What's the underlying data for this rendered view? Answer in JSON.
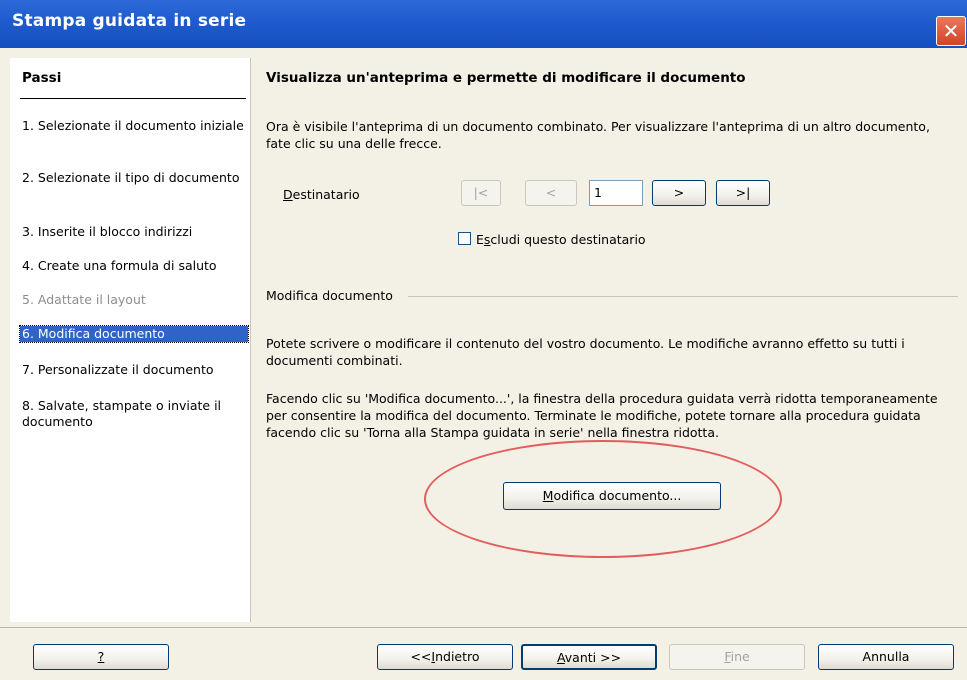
{
  "window": {
    "title": "Stampa guidata in serie",
    "close_glyph": "✕"
  },
  "sidebar": {
    "heading": "Passi",
    "steps": [
      {
        "label": "1. Selezionate il documento iniziale",
        "state": "normal"
      },
      {
        "label": "2. Selezionate il tipo di documento",
        "state": "normal"
      },
      {
        "label": "3. Inserite il blocco indirizzi",
        "state": "normal"
      },
      {
        "label": "4. Create una formula di saluto",
        "state": "normal"
      },
      {
        "label": "5. Adattate il layout",
        "state": "disabled"
      },
      {
        "label": "6. Modifica documento",
        "state": "active"
      },
      {
        "label": "7. Personalizzate il documento",
        "state": "normal"
      },
      {
        "label": "8. Salvate, stampate o inviate il documento",
        "state": "normal"
      }
    ]
  },
  "main": {
    "heading": "Visualizza un'anteprima e permette di modificare il documento",
    "intro": "Ora è visibile l'anteprima di un documento combinato. Per visualizzare l'anteprima di un altro documento, fate clic su una delle frecce.",
    "recipient": {
      "label_first": "D",
      "label_rest": "estinatario",
      "first_btn": "|<",
      "prev_btn": "<",
      "value": "1",
      "next_btn": ">",
      "last_btn": ">|"
    },
    "exclude": {
      "pre": "E",
      "underlined": "s",
      "post": "cludi questo destinatario",
      "checked": false
    },
    "section_label": "Modifica documento",
    "para1": "Potete scrivere o modificare il contenuto del vostro documento. Le modifiche avranno effetto su tutti i documenti combinati.",
    "para2": "Facendo clic su 'Modifica documento...', la finestra della procedura guidata verrà ridotta temporaneamente per consentire la modifica del documento. Terminate le modifiche, potete tornare alla procedura guidata facendo clic su 'Torna alla Stampa guidata in serie' nella finestra ridotta.",
    "edit_button": {
      "underlined": "M",
      "rest": "odifica documento..."
    },
    "highlight_color": "#e35d5d"
  },
  "footer": {
    "help": "?",
    "back": {
      "pre": "<<",
      "underlined": "I",
      "rest": "ndietro"
    },
    "next": {
      "underlined": "A",
      "rest": "vanti >>"
    },
    "finish": {
      "underlined": "F",
      "rest": "ine",
      "enabled": false
    },
    "cancel": "Annulla"
  },
  "colors": {
    "titlebar": "#1f5ccf",
    "selection": "#3162c8",
    "dialog_bg": "#f3f1e6"
  }
}
